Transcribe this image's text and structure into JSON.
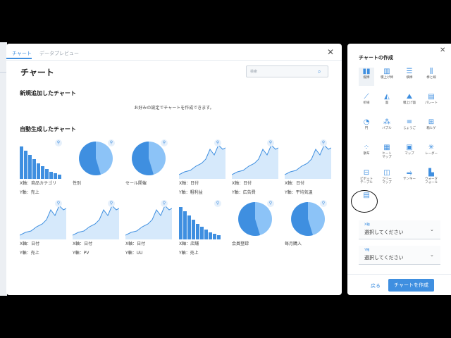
{
  "dialog": {
    "tabs": [
      "チャート",
      "データプレビュー"
    ],
    "title": "チャート",
    "search_placeholder": "検索",
    "new_section_title": "新規追加したチャート",
    "new_section_desc": "お好みの設定でチャートを作成できます。",
    "auto_section_title": "自動生成したチャート",
    "pin_icon": "pin-icon",
    "accent": "#3f8fe0"
  },
  "cards": [
    {
      "type": "bar",
      "line1": "X軸：商品カテゴリ",
      "line2": "Y軸：売上"
    },
    {
      "type": "pie",
      "line1": "性別",
      "line2": ""
    },
    {
      "type": "pie",
      "line1": "セール開催",
      "line2": ""
    },
    {
      "type": "area",
      "line1": "X軸：日付",
      "line2": "Y軸：粗利益"
    },
    {
      "type": "area",
      "line1": "X軸：日付",
      "line2": "Y軸：広告費"
    },
    {
      "type": "area",
      "line1": "X軸：日付",
      "line2": "Y軸：平均気温"
    },
    {
      "type": "area",
      "line1": "X軸：日付",
      "line2": "Y軸：売上"
    },
    {
      "type": "area",
      "line1": "X軸：日付",
      "line2": "Y軸：PV"
    },
    {
      "type": "area",
      "line1": "X軸：日付",
      "line2": "Y軸：UU"
    },
    {
      "type": "bar",
      "line1": "X軸：店舗",
      "line2": "Y軸：売上"
    },
    {
      "type": "pie",
      "line1": "会員登録",
      "line2": ""
    },
    {
      "type": "pie",
      "line1": "毎月購入",
      "line2": ""
    }
  ],
  "side": {
    "title": "チャートの作成",
    "chart_types": [
      {
        "label": "縦棒",
        "icon": "vertical-bar-icon"
      },
      {
        "label": "積上げ棒",
        "icon": "stacked-bar-icon"
      },
      {
        "label": "横棒",
        "icon": "horizontal-bar-icon"
      },
      {
        "label": "棒と線",
        "icon": "bar-line-icon"
      },
      {
        "label": "折線",
        "icon": "line-icon"
      },
      {
        "label": "面",
        "icon": "area-icon"
      },
      {
        "label": "積上げ面",
        "icon": "stacked-area-icon"
      },
      {
        "label": "パレート",
        "icon": "pareto-icon"
      },
      {
        "label": "円",
        "icon": "pie-icon"
      },
      {
        "label": "バブル",
        "icon": "bubble-icon"
      },
      {
        "label": "じょうご",
        "icon": "funnel-icon"
      },
      {
        "label": "箱ヒゲ",
        "icon": "boxplot-icon"
      },
      {
        "label": "散布",
        "icon": "scatter-icon"
      },
      {
        "label": "ヒート\nマップ",
        "icon": "heatmap-icon"
      },
      {
        "label": "マップ",
        "icon": "map-icon"
      },
      {
        "label": "レーダー",
        "icon": "radar-icon"
      },
      {
        "label": "ピボット\nテーブル",
        "icon": "pivot-table-icon"
      },
      {
        "label": "ツリー\nマップ",
        "icon": "treemap-icon"
      },
      {
        "label": "サンキー",
        "icon": "sankey-icon"
      },
      {
        "label": "ウォータ\nフォール",
        "icon": "waterfall-icon"
      },
      {
        "label": "",
        "icon": "kpi-icon"
      }
    ],
    "x_field": {
      "label": "X軸",
      "value": "選択してください"
    },
    "y_field": {
      "label": "Y軸",
      "value": "選択してください"
    },
    "back_label": "戻る",
    "create_label": "チャートを作成"
  }
}
